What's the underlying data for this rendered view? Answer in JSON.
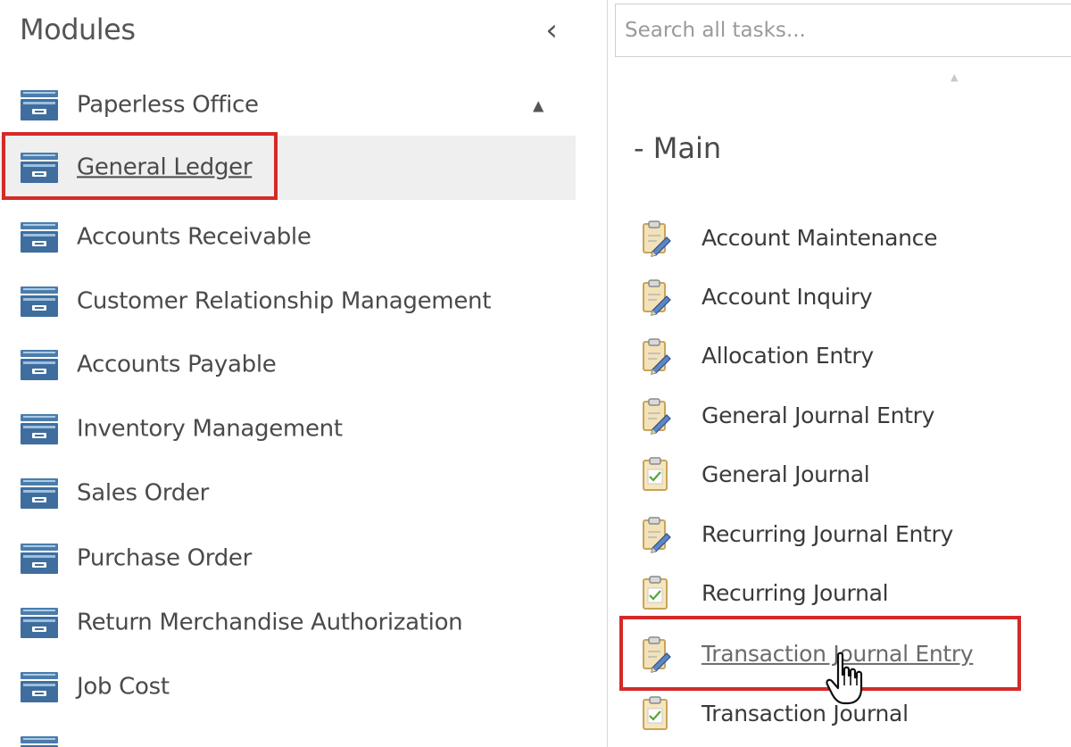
{
  "modules_panel": {
    "title": "Modules",
    "collapse_icon": "chevron-left-icon",
    "items": [
      {
        "label": "Paperless Office",
        "icon": "folder-icon",
        "expanded_caret": "▲"
      },
      {
        "label": "General Ledger",
        "icon": "folder-icon",
        "selected": true
      },
      {
        "label": "Accounts Receivable",
        "icon": "folder-icon"
      },
      {
        "label": "Customer Relationship Management",
        "icon": "folder-icon"
      },
      {
        "label": "Accounts Payable",
        "icon": "folder-icon"
      },
      {
        "label": "Inventory Management",
        "icon": "folder-icon"
      },
      {
        "label": "Sales Order",
        "icon": "folder-icon"
      },
      {
        "label": "Purchase Order",
        "icon": "folder-icon"
      },
      {
        "label": "Return Merchandise Authorization",
        "icon": "folder-icon"
      },
      {
        "label": "Job Cost",
        "icon": "folder-icon"
      },
      {
        "label": "",
        "icon": "folder-icon"
      }
    ]
  },
  "tasks_panel": {
    "search": {
      "placeholder": "Search all tasks..."
    },
    "scroll_up_icon": "▲",
    "section": {
      "title": "- Main"
    },
    "tasks": [
      {
        "label": "Account Maintenance",
        "icon": "clipboard-pencil-icon"
      },
      {
        "label": "Account Inquiry",
        "icon": "clipboard-pencil-icon"
      },
      {
        "label": "Allocation Entry",
        "icon": "clipboard-pencil-icon"
      },
      {
        "label": "General Journal Entry",
        "icon": "clipboard-pencil-icon"
      },
      {
        "label": "General Journal",
        "icon": "clipboard-check-icon"
      },
      {
        "label": "Recurring Journal Entry",
        "icon": "clipboard-pencil-icon"
      },
      {
        "label": "Recurring Journal",
        "icon": "clipboard-check-icon"
      },
      {
        "label": "Transaction Journal Entry",
        "icon": "clipboard-pencil-icon",
        "hovered": true
      },
      {
        "label": "Transaction Journal",
        "icon": "clipboard-check-icon"
      }
    ]
  },
  "colors": {
    "highlight": "#d42a27",
    "folder": "#4a7aa8",
    "selected_bg": "#efefef"
  }
}
